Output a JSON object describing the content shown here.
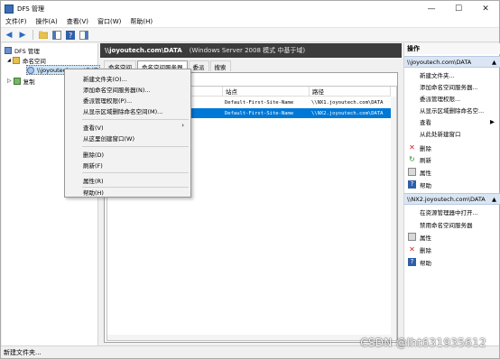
{
  "window": {
    "title": "DFS 管理"
  },
  "title_buttons": {
    "minimize": "—",
    "maximize": "☐",
    "close": "✕"
  },
  "menubar": [
    "文件(F)",
    "操作(A)",
    "查看(V)",
    "窗口(W)",
    "帮助(H)"
  ],
  "tree": {
    "root": "DFS 管理",
    "namespaces": "命名空间",
    "namespace_item": "\\\\joyoutech.com\\DAT",
    "replication": "复制"
  },
  "middle": {
    "header_title": "\\\\joyoutech.com\\DATA",
    "header_subtitle": "(Windows Server 2008 模式 中基于域)",
    "tabs": [
      "命名空间",
      "命名空间服务器",
      "委派",
      "搜索"
    ],
    "columns": [
      "站点",
      "路径"
    ],
    "rows": [
      {
        "site": "Default-First-Site-Name",
        "path": "\\\\NX1.joyoutech.com\\DATA"
      },
      {
        "site": "Default-First-Site-Name",
        "path": "\\\\NX2.joyoutech.com\\DATA"
      }
    ]
  },
  "context_menu": [
    "新建文件夹(O)...",
    "添加命名空间服务器(N)...",
    "委派管理权限(P)...",
    "从显示区域删除命名空间(M)...",
    "查看(V)",
    "从这里创建窗口(W)",
    "删除(D)",
    "刷新(F)",
    "属性(R)",
    "帮助(H)"
  ],
  "actions": {
    "title": "操作",
    "section1": "\\\\joyoutech.com\\DATA",
    "section1_items": [
      "新建文件夹...",
      "添加命名空间服务器...",
      "委派管理权限...",
      "从显示区域删除命名空...",
      "查看",
      "从此处新建窗口",
      "删除",
      "刷新",
      "属性",
      "帮助"
    ],
    "section2": "\\\\NX2.joyoutech.com\\DATA",
    "section2_items": [
      "在资源管理器中打开...",
      "禁用命名空间服务器",
      "属性",
      "删除",
      "帮助"
    ]
  },
  "status": "新建文件夹...",
  "watermark": "CSDN @lht631935612",
  "colors": {
    "selection": "#0078d7",
    "header_bg": "#3c3c3c",
    "section_bg": "#dbe6f4"
  }
}
